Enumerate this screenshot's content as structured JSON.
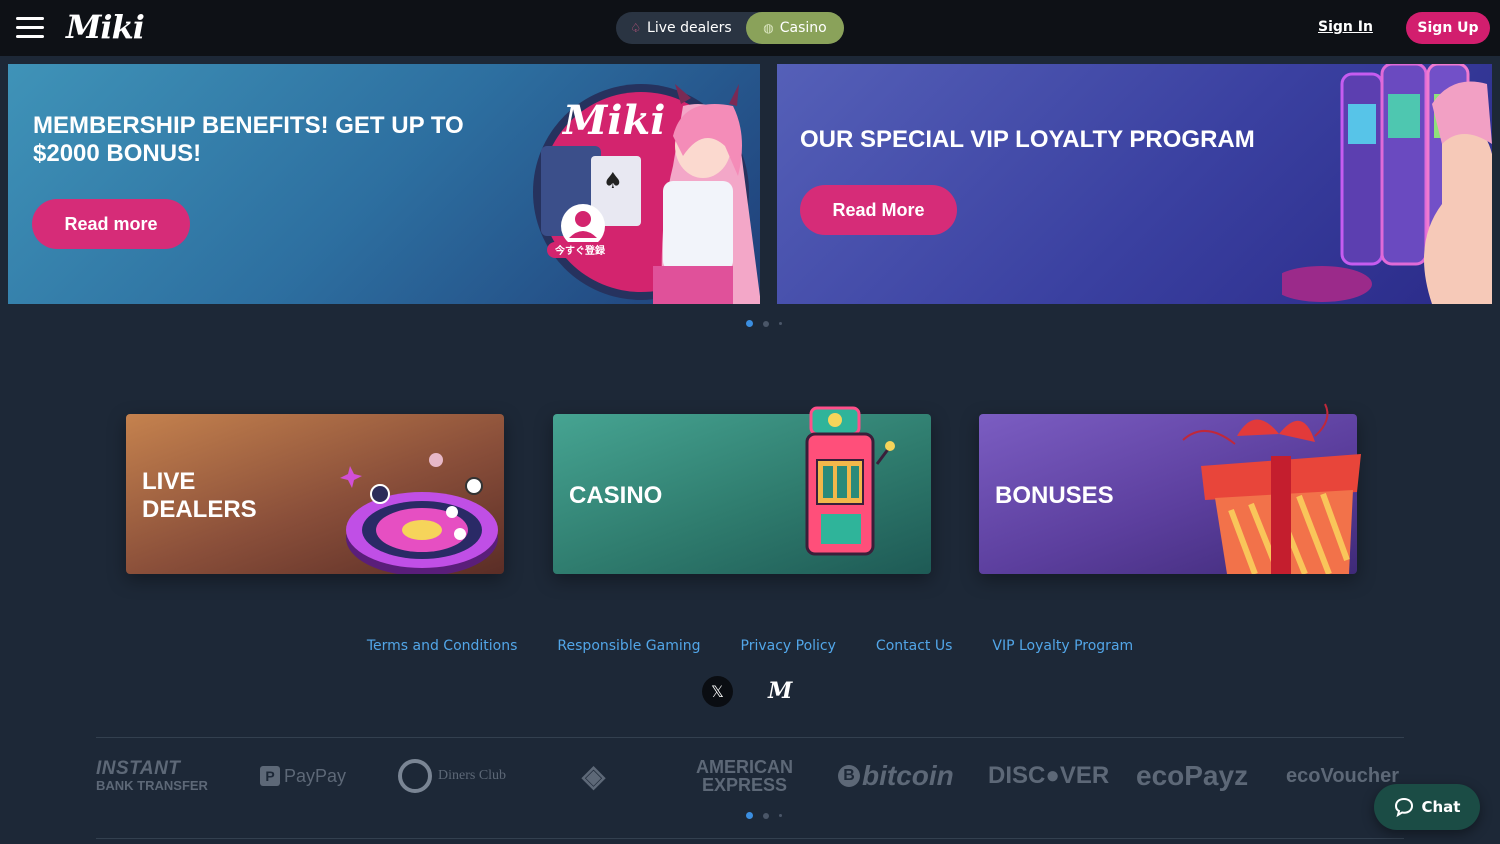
{
  "header": {
    "logo_text": "Miki",
    "mode_live_label": "Live dealers",
    "mode_casino_label": "Casino",
    "signin_label": "Sign In",
    "signup_label": "Sign Up",
    "active_mode": "Casino"
  },
  "banners": [
    {
      "title": "MEMBERSHIP BENEFITS! GET UP TO $2000 BONUS!",
      "button": "Read more",
      "art_logo": "Miki",
      "art_badge": "今すぐ登録"
    },
    {
      "title": "OUR SPECIAL VIP LOYALTY PROGRAM",
      "button": "Read More"
    }
  ],
  "carousel": {
    "pages": 3,
    "active": 1
  },
  "categories": [
    {
      "title": "LIVE DEALERS",
      "icon": "roulette-icon"
    },
    {
      "title": "CASINO",
      "icon": "slot-machine-icon"
    },
    {
      "title": "BONUSES",
      "icon": "gift-icon"
    }
  ],
  "footer": {
    "links": [
      "Terms and Conditions",
      "Responsible Gaming",
      "Privacy Policy",
      "Contact Us",
      "VIP Loyalty Program"
    ],
    "social": {
      "x_glyph": "𝕏",
      "m_glyph": "M"
    }
  },
  "payments": {
    "instant_big": "INSTANT",
    "instant_small": "BANK TRANSFER",
    "paypay": "PayPay",
    "paypay_box": "P",
    "diners": "Diners Club",
    "binance": "◈",
    "amex_1": "AMERICAN",
    "amex_2": "EXPRESS",
    "bitcoin_b": "B",
    "bitcoin": "bitcoin",
    "discover": "DISC●VER",
    "ecopayz": "ecoPayz",
    "ecovoucher": "ecoVoucher"
  },
  "chat": {
    "label": "Chat"
  },
  "colors": {
    "brand_pink": "#d62c78",
    "casino_active": "#8aa25a",
    "link_blue": "#52a6e8",
    "page_bg": "#1d2837"
  }
}
